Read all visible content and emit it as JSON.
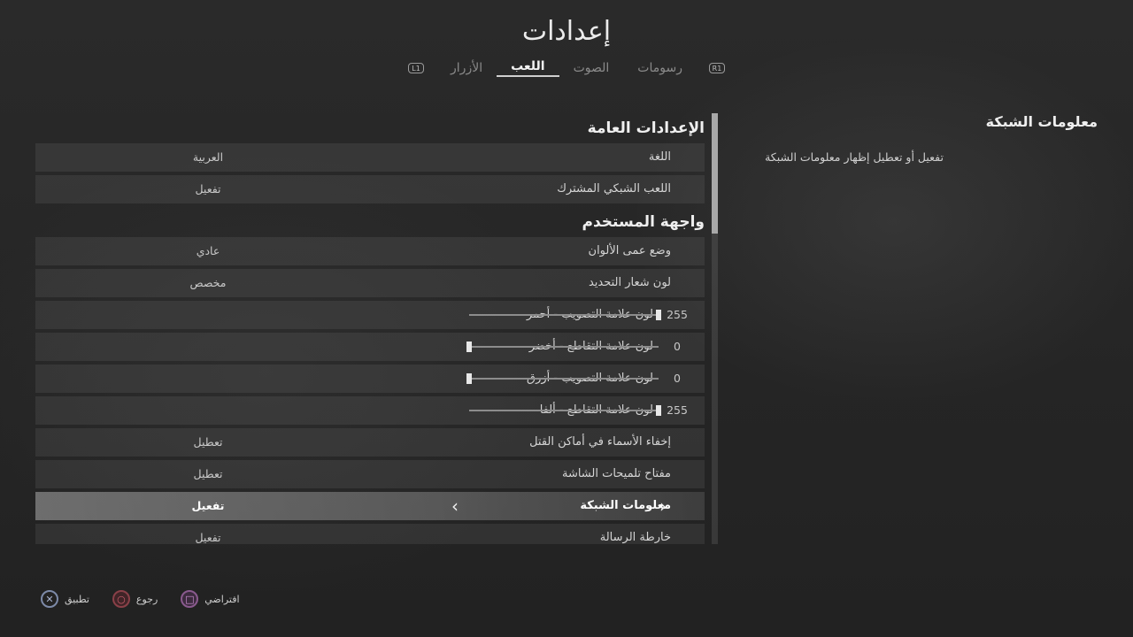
{
  "header": {
    "title": "إعدادات",
    "tabs": [
      {
        "label": "رسومات",
        "active": false
      },
      {
        "label": "الصوت",
        "active": false
      },
      {
        "label": "اللعب",
        "active": true
      },
      {
        "label": "الأزرار",
        "active": false
      }
    ],
    "left_bumper": "L1",
    "right_bumper": "R1"
  },
  "settings": {
    "sections": [
      {
        "title": "الإعدادات العامة",
        "rows": [
          {
            "label": "اللغة",
            "value": "العربية"
          },
          {
            "label": "اللعب الشبكي المشترك",
            "value": "تفعيل"
          }
        ]
      },
      {
        "title": "واجهة المستخدم",
        "rows": [
          {
            "label": "وضع عمى الألوان",
            "value": "عادي"
          },
          {
            "label": "لون شعار التحديد",
            "value": "مخصص"
          },
          {
            "label": "لون علامة التصويب - أحمر",
            "slider": 255,
            "max": 255
          },
          {
            "label": "لون علامة التقاطع - أخضر",
            "slider": 0,
            "max": 255
          },
          {
            "label": "لون علامة التصويب - أزرق",
            "slider": 0,
            "max": 255
          },
          {
            "label": "لون علامة التقاطع - ألفا",
            "slider": 255,
            "max": 255
          },
          {
            "label": "إخفاء الأسماء في أماكن القتل",
            "value": "تعطيل"
          },
          {
            "label": "مفتاح تلميحات الشاشة",
            "value": "تعطيل"
          },
          {
            "label": "معلومات الشبكة",
            "value": "تفعيل",
            "selected": true
          },
          {
            "label": "خارطة الرسالة",
            "value": "تفعيل"
          }
        ]
      }
    ]
  },
  "info_panel": {
    "title": "معلومات الشبكة",
    "description": "تفعيل أو تعطيل إظهار معلومات الشبكة"
  },
  "footer": {
    "buttons": [
      {
        "icon": "cross-button-icon",
        "glyph": "✕",
        "label": "تطبيق"
      },
      {
        "icon": "circle-button-icon",
        "glyph": "○",
        "label": "رجوع"
      },
      {
        "icon": "square-button-icon",
        "glyph": "□",
        "label": "افتراضي"
      }
    ]
  }
}
